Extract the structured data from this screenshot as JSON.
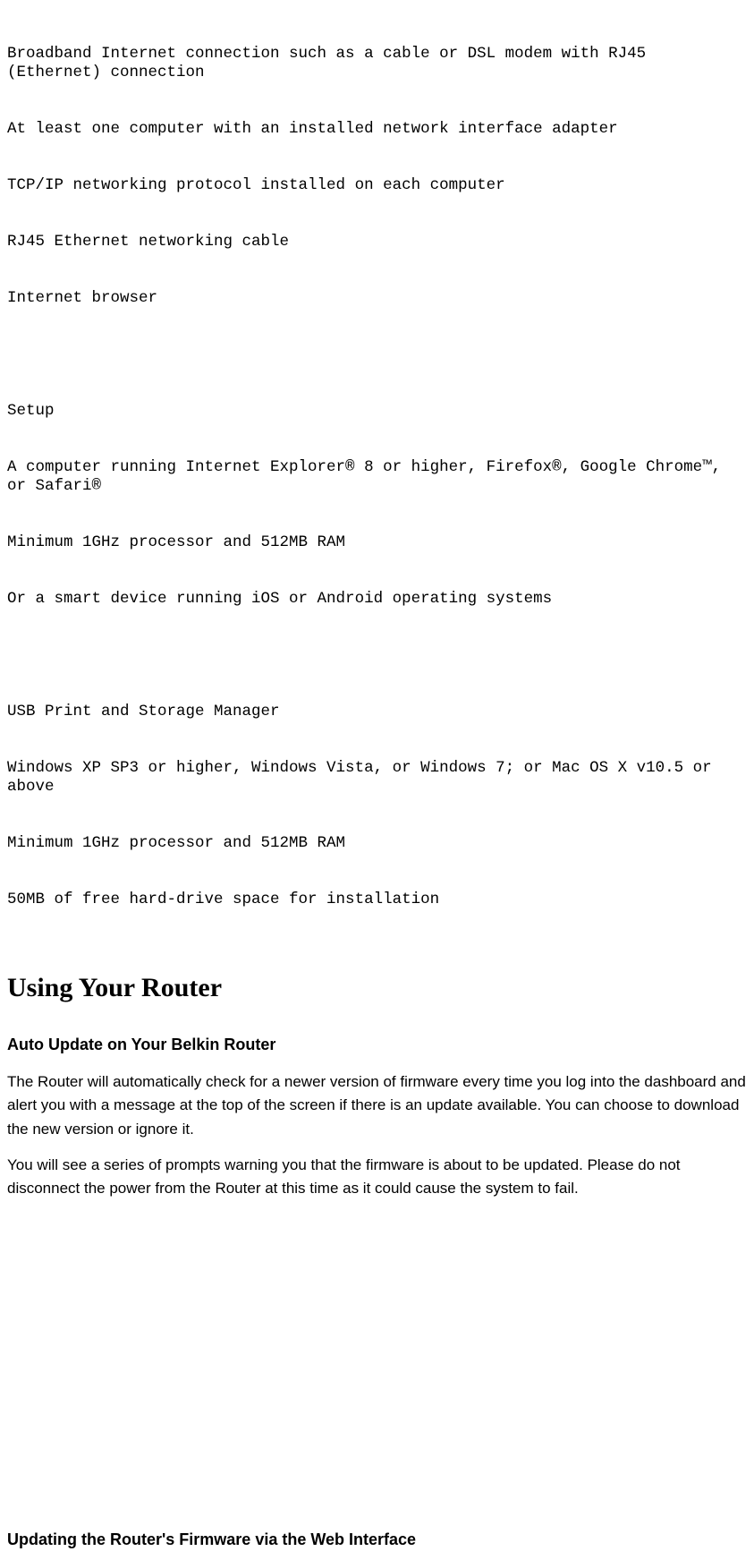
{
  "requirements": {
    "lines": [
      "Broadband Internet connection such as a cable or DSL modem with RJ45 (Ethernet) connection",
      "At least one computer with an installed network interface adapter",
      "TCP/IP networking protocol installed on each computer",
      "RJ45 Ethernet networking cable",
      "Internet browser"
    ]
  },
  "setup": {
    "heading": "Setup",
    "lines": [
      "A computer running Internet Explorer® 8 or higher, Firefox®, Google Chrome™, or Safari®",
      "Minimum 1GHz processor and 512MB RAM",
      "Or a smart device running iOS or Android operating systems"
    ]
  },
  "usb": {
    "heading": "USB Print and Storage Manager",
    "lines": [
      "Windows XP SP3 or higher, Windows Vista, or Windows 7; or Mac OS X v10.5 or above",
      "Minimum 1GHz processor and 512MB RAM",
      "50MB of free hard-drive space for installation"
    ]
  },
  "section": {
    "title": "Using Your Router",
    "sub1": {
      "title": "Auto Update on Your Belkin Router",
      "p1": "The Router will automatically check for a newer version of firmware every time you log into the dashboard and alert you with a message at the top of the screen if there is an update available. You can choose to download the new version or ignore it.",
      "p2": "You will see a series of prompts warning you that the firmware is about to be updated. Please do not disconnect the power from the Router at this time as it could cause the system to fail."
    },
    "sub2": {
      "title": "Updating the Router's Firmware via the Web Interface"
    }
  }
}
